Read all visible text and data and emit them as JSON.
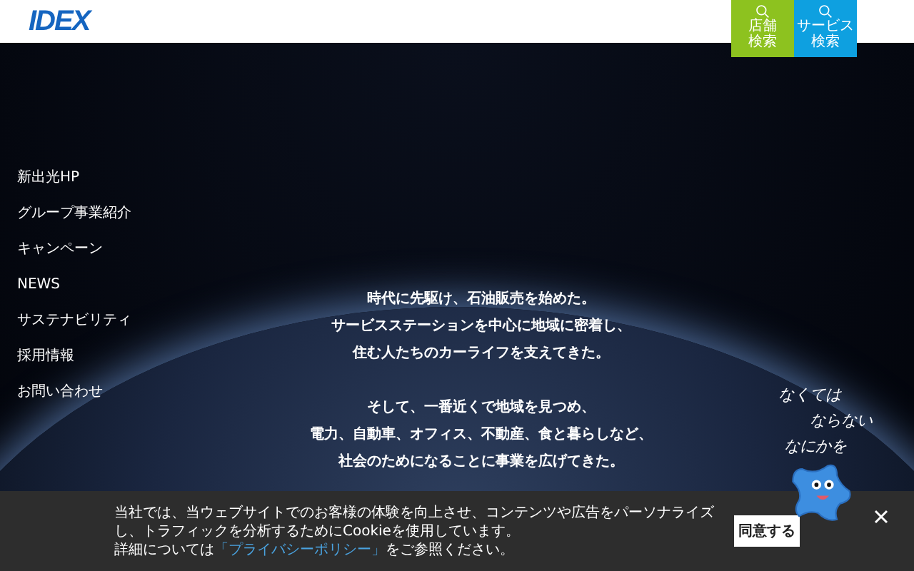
{
  "header": {
    "logo": "IDEX",
    "buttons": [
      {
        "lines": [
          "店舗",
          "検索"
        ],
        "color": "#8dc21f"
      },
      {
        "lines": [
          "サービス",
          "検索"
        ],
        "color": "#0ea0e0"
      }
    ]
  },
  "nav": {
    "items": [
      "新出光HP",
      "グループ事業紹介",
      "キャンペーン",
      "NEWS",
      "サステナビリティ",
      "採用情報",
      "お問い合わせ"
    ]
  },
  "hero": {
    "paragraphs": [
      [
        "時代に先駆け、石油販売を始めた。",
        "サービスステーションを中心に地域に密着し、",
        "住む人たちのカーライフを支えてきた。"
      ],
      [
        "そして、一番近くで地域を見つめ、",
        "電力、自動車、オフィス、不動産、食と暮らしなど、",
        "社会のためになることに事業を広げてきた。"
      ]
    ],
    "handwritten": [
      "なくては",
      "ならない",
      "なにかを"
    ]
  },
  "cookie_banner": {
    "text": "当社では、当ウェブサイトでのお客様の体験を向上させ、コンテンツや広告をパーソナライズし、トラフィックを分析するためにCookieを使用しています。",
    "detail_before": "詳細については",
    "link": "「プライバシーポリシー」",
    "detail_after": "をご参照ください。",
    "accept_button": "同意する"
  }
}
